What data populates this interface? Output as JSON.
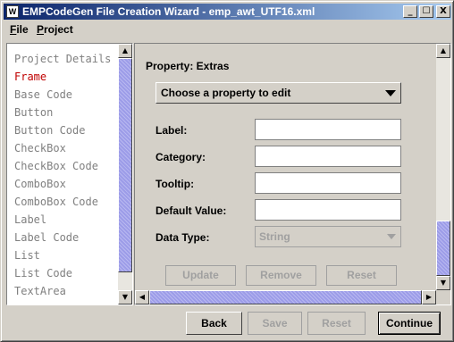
{
  "window": {
    "title": "EMPCodeGen File Creation Wizard - emp_awt_UTF16.xml",
    "icon": "W",
    "controls": {
      "minimize": "_",
      "maximize": "☐",
      "close": "X"
    }
  },
  "menubar": {
    "items": [
      {
        "label": "File",
        "mnemonic": "F",
        "rest": "ile"
      },
      {
        "label": "Project",
        "mnemonic": "P",
        "rest": "roject"
      }
    ]
  },
  "nav": {
    "items": [
      {
        "label": "Project Details",
        "active": false
      },
      {
        "label": "Frame",
        "active": true
      },
      {
        "label": "Base Code",
        "active": false
      },
      {
        "label": "Button",
        "active": false
      },
      {
        "label": "Button Code",
        "active": false
      },
      {
        "label": "CheckBox",
        "active": false
      },
      {
        "label": "CheckBox Code",
        "active": false
      },
      {
        "label": "ComboBox",
        "active": false
      },
      {
        "label": "ComboBox Code",
        "active": false
      },
      {
        "label": "Label",
        "active": false
      },
      {
        "label": "Label Code",
        "active": false
      },
      {
        "label": "List",
        "active": false
      },
      {
        "label": "List Code",
        "active": false
      },
      {
        "label": "TextArea",
        "active": false
      }
    ],
    "active_color": "#c00000",
    "inactive_color": "#808080"
  },
  "editor": {
    "heading": "Property: Extras",
    "property_select": "Choose a property to edit",
    "fields": {
      "label": {
        "label": "Label:",
        "value": ""
      },
      "category": {
        "label": "Category:",
        "value": ""
      },
      "tooltip": {
        "label": "Tooltip:",
        "value": ""
      },
      "default_value": {
        "label": "Default Value:",
        "value": ""
      },
      "data_type": {
        "label": "Data Type:",
        "value": "String"
      }
    },
    "buttons": {
      "update": "Update",
      "remove": "Remove",
      "reset": "Reset"
    }
  },
  "footer": {
    "back": "Back",
    "save": "Save",
    "reset": "Reset",
    "continue": "Continue"
  },
  "colors": {
    "titlebar_start": "#0a246a",
    "titlebar_end": "#a6caf0",
    "scroll_thumb": "#9c9ce8",
    "window_bg": "#d4d0c8"
  }
}
